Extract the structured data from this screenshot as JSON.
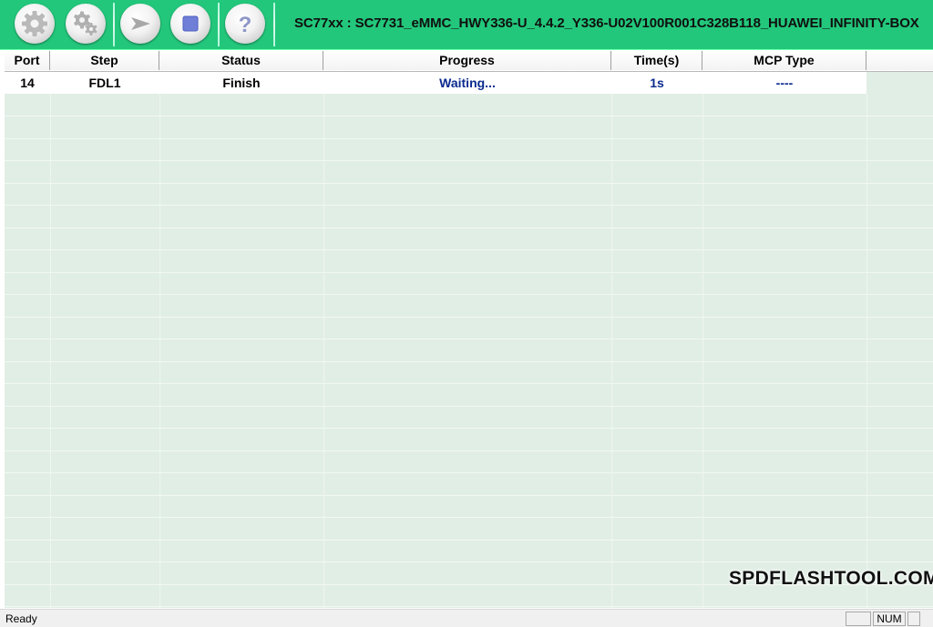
{
  "toolbar": {
    "title": "SC77xx : SC7731_eMMC_HWY336-U_4.4.2_Y336-U02V100R001C328B118_HUAWEI_INFINITY-BOX",
    "buttons": [
      {
        "icon": "gear-icon"
      },
      {
        "icon": "gears-icon"
      },
      {
        "icon": "play-arrow-icon"
      },
      {
        "icon": "stop-square-icon"
      },
      {
        "icon": "help-question-icon"
      }
    ]
  },
  "table": {
    "columns": [
      "Port",
      "Step",
      "Status",
      "Progress",
      "Time(s)",
      "MCP Type"
    ],
    "rows": [
      {
        "port": "14",
        "step": "FDL1",
        "status": "Finish",
        "progress": "Waiting...",
        "time": "1s",
        "mcp": "----"
      }
    ]
  },
  "watermark": "SPDFLASHTOOL.COM",
  "statusbar": {
    "text": "Ready",
    "num": "NUM"
  },
  "colors": {
    "toolbar_bg": "#22c77b",
    "grid_bg": "#e1eee5",
    "value_blue": "#0b2b8f"
  }
}
